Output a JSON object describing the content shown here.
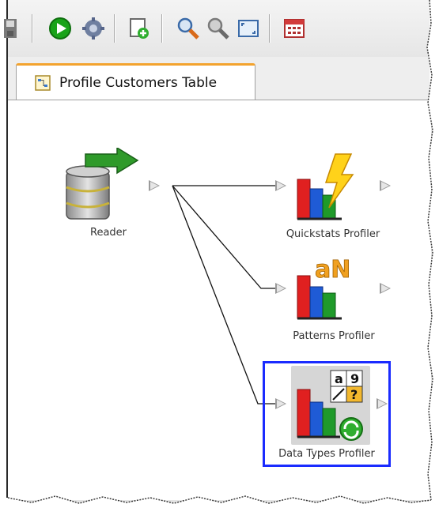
{
  "toolbar": {
    "buttons": [
      {
        "name": "save-icon"
      },
      {
        "name": "run-icon"
      },
      {
        "name": "settings-icon"
      },
      {
        "name": "add-document-icon"
      },
      {
        "name": "zoom-in-icon"
      },
      {
        "name": "zoom-out-icon"
      },
      {
        "name": "fit-to-screen-icon"
      },
      {
        "name": "calendar-icon"
      }
    ]
  },
  "tab": {
    "label": "Profile Customers Table",
    "icon": "process-icon",
    "accent_color": "#f3a32e"
  },
  "nodes": {
    "reader": {
      "label": "Reader",
      "icon": "database-reader-icon"
    },
    "quickstats": {
      "label": "Quickstats Profiler",
      "icon": "quickstats-profiler-icon"
    },
    "patterns": {
      "label": "Patterns Profiler",
      "icon": "patterns-profiler-icon",
      "badge": "aN"
    },
    "datatypes": {
      "label": "Data Types Profiler",
      "icon": "data-types-profiler-icon",
      "selected": true,
      "badge_a": "a",
      "badge_9": "9",
      "badge_q": "?"
    }
  },
  "colors": {
    "selection": "#1a2bff",
    "run": "#19a319",
    "bar_red": "#e02020",
    "bar_blue": "#1f5bd6",
    "bar_green": "#1f9a2a"
  }
}
